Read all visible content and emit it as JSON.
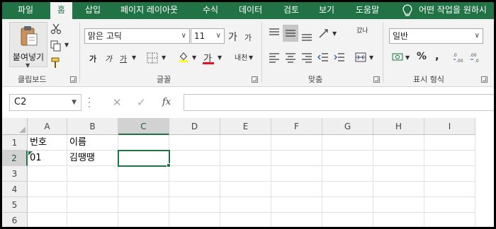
{
  "ribbon_tabs": [
    {
      "label": "파일"
    },
    {
      "label": "홈"
    },
    {
      "label": "삽입"
    },
    {
      "label": "페이지 레이아웃"
    },
    {
      "label": "수식"
    },
    {
      "label": "데이터"
    },
    {
      "label": "검토"
    },
    {
      "label": "보기"
    },
    {
      "label": "도움말"
    }
  ],
  "tell_me": {
    "icon": "lightbulb-icon",
    "text": "어떤 작업을 원하시"
  },
  "clipboard": {
    "paste_label": "붙여넣기",
    "group_label": "클립보드"
  },
  "font": {
    "name": "맑은 고딕",
    "size": "11",
    "grow": "가",
    "shrink": "가",
    "bold": "가",
    "italic": "가",
    "underline": "가",
    "color_letter": "가",
    "phonetic": "내천",
    "group_label": "글꼴",
    "color_accent": "#e81123"
  },
  "alignment": {
    "wrap_label": "갔나",
    "group_label": "맞춤"
  },
  "number": {
    "format": "일반",
    "percent": "%",
    "comma": ",",
    "group_label": "표시 형식"
  },
  "formula_bar": {
    "name_box": "C2",
    "cancel": "✕",
    "enter": "✓",
    "fx": "fx",
    "value": ""
  },
  "sheet": {
    "columns": [
      "A",
      "B",
      "C",
      "D",
      "E",
      "F",
      "G",
      "H",
      "I"
    ],
    "selected_column": "C",
    "rows": [
      "1",
      "2",
      "3",
      "4",
      "5",
      "6"
    ],
    "selected_row": "2",
    "active_cell": "C2",
    "cells": {
      "A1": "번호",
      "B1": "이름",
      "A2": "01",
      "B2": "김땡땡"
    }
  },
  "colors": {
    "accent": "#217346",
    "ribbon_bg": "#f3f3f3"
  }
}
